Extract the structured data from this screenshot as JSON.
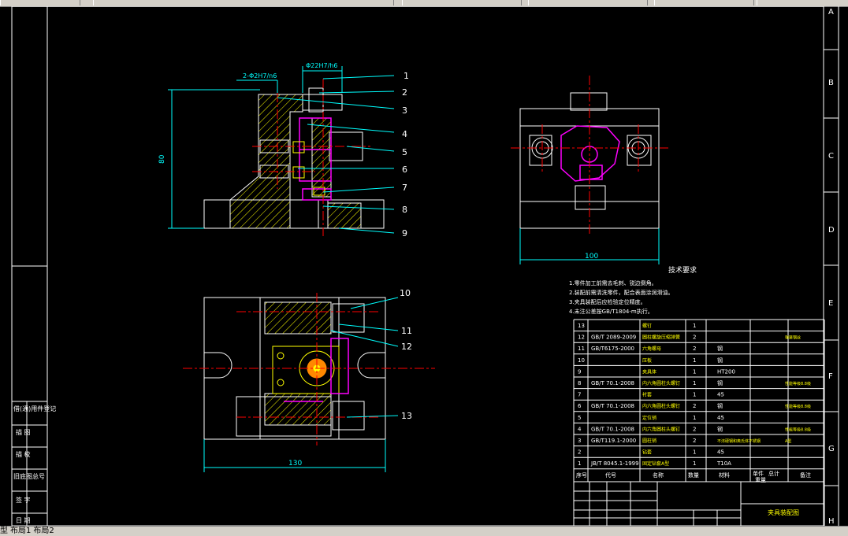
{
  "tabs": {
    "model": "型",
    "layout1": "布局1",
    "layout2": "布局2"
  },
  "border_zones": [
    "A",
    "B",
    "C",
    "D",
    "E",
    "F",
    "G",
    "H"
  ],
  "front_view": {
    "tol_left": "2-Φ2H7/n6",
    "tol_top": "Φ22H7/h6",
    "height_dim": "80",
    "balloons": [
      "1",
      "2",
      "3",
      "4",
      "5",
      "6",
      "7",
      "8",
      "9"
    ]
  },
  "side_view": {
    "width_dim": "100"
  },
  "top_view": {
    "width_dim": "130",
    "balloons": [
      "10",
      "11",
      "12",
      "13"
    ]
  },
  "tech_req": {
    "title": "技术要求",
    "lines": [
      "1.零件加工前需去毛刺、锐边倒角。",
      "2.装配前需清洗零件，配合表面涂润滑油。",
      "3.夹具装配后应检验定位精度。",
      "4.未注公差按GB/T1804-m执行。"
    ]
  },
  "bom": {
    "rows": [
      {
        "no": "13",
        "std": "",
        "name": "螺钉",
        "qty": "1",
        "mat": "",
        "note": ""
      },
      {
        "no": "12",
        "std": "GB/T 2089-2009",
        "name": "圆柱螺旋压缩弹簧",
        "qty": "2",
        "mat": "",
        "note": "弹簧钢丝"
      },
      {
        "no": "11",
        "std": "GB/T6175-2000",
        "name": "六角螺母",
        "qty": "2",
        "mat": "钢",
        "note": ""
      },
      {
        "no": "10",
        "std": "",
        "name": "压板",
        "qty": "1",
        "mat": "钢",
        "note": ""
      },
      {
        "no": "9",
        "std": "",
        "name": "夹具体",
        "qty": "1",
        "mat": "HT200",
        "note": ""
      },
      {
        "no": "8",
        "std": "GB/T 70.1-2008",
        "name": "内六角圆柱头螺钉",
        "qty": "1",
        "mat": "钢",
        "note": "性能等级8.8级"
      },
      {
        "no": "7",
        "std": "",
        "name": "衬套",
        "qty": "1",
        "mat": "45",
        "note": ""
      },
      {
        "no": "6",
        "std": "GB/T 70.1-2008",
        "name": "内六角圆柱头螺钉",
        "qty": "2",
        "mat": "钢",
        "note": "性能等级8.8级"
      },
      {
        "no": "5",
        "std": "",
        "name": "定位销",
        "qty": "1",
        "mat": "45",
        "note": ""
      },
      {
        "no": "4",
        "std": "GB/T 70.1-2008",
        "name": "内六角圆柱头螺钉",
        "qty": "2",
        "mat": "钢",
        "note": "性能等级8.8级"
      },
      {
        "no": "3",
        "std": "GB/T119.1-2000",
        "name": "圆柱销",
        "qty": "2",
        "mat": "不淬硬钢和奥氏体不锈钢",
        "note": "A型"
      },
      {
        "no": "2",
        "std": "",
        "name": "钻套",
        "qty": "1",
        "mat": "45",
        "note": ""
      },
      {
        "no": "1",
        "std": "JB/T 8045.1-1999",
        "name": "固定钻套A型",
        "qty": "1",
        "mat": "T10A",
        "note": ""
      }
    ],
    "header": {
      "no": "序号",
      "std": "代号",
      "name": "名称",
      "qty": "数量",
      "mat": "材料",
      "unit": "单件",
      "total": "总计",
      "weight": "重量",
      "note": "备注"
    },
    "title": "夹具装配图"
  },
  "left_strip": [
    "借(通)用件登记",
    "描 图",
    "描 校",
    "旧底图总号",
    "签 字",
    "日 期"
  ],
  "colors": {
    "background": "#000000",
    "lines": "#ffffff",
    "dims": "#00ffff",
    "center": "#ff0000",
    "part": "#ff00ff",
    "hatch": "#ffff00"
  }
}
